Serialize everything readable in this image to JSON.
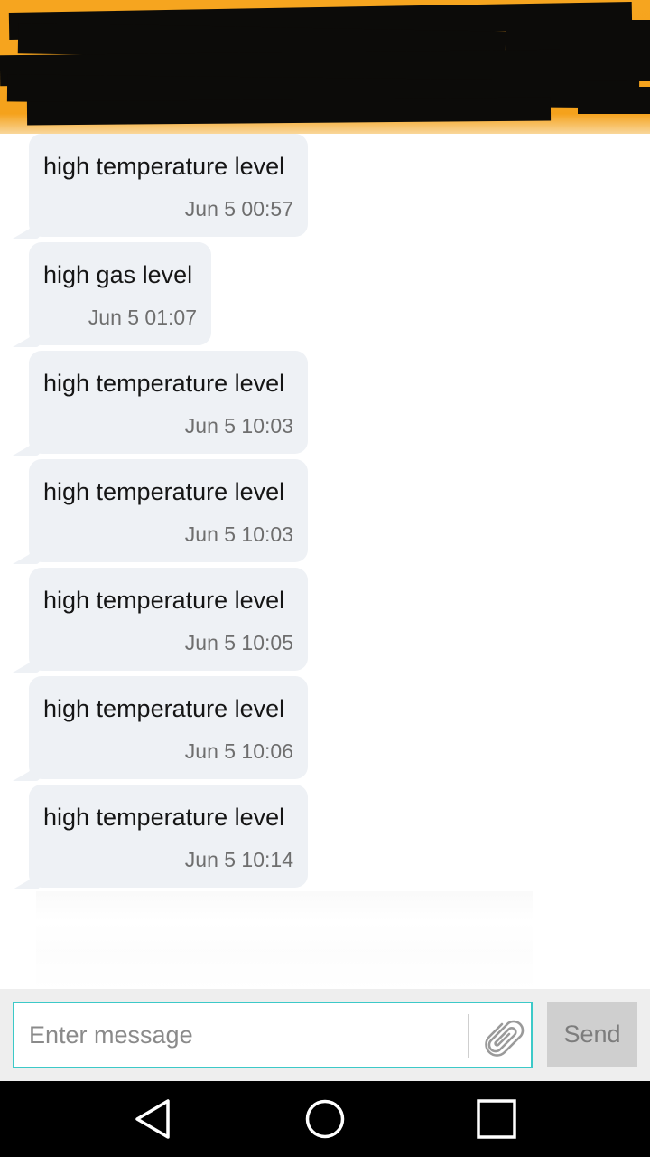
{
  "messages": [
    {
      "text": "high temperature level",
      "time": "Jun 5 00:57"
    },
    {
      "text": "high gas level",
      "time": "Jun 5 01:07"
    },
    {
      "text": "high temperature level",
      "time": "Jun 5 10:03"
    },
    {
      "text": "high temperature level",
      "time": "Jun 5 10:03"
    },
    {
      "text": "high temperature level",
      "time": "Jun 5 10:05"
    },
    {
      "text": "high temperature level",
      "time": "Jun 5 10:06"
    },
    {
      "text": "high temperature level",
      "time": "Jun 5 10:14"
    }
  ],
  "composer": {
    "placeholder": "Enter message",
    "send_label": "Send"
  },
  "icons": {
    "attach": "paperclip-icon",
    "back": "back-triangle-icon",
    "home": "home-circle-icon",
    "recents": "recents-square-icon"
  },
  "colors": {
    "header": "#f5a21c",
    "bubble": "#eef1f5",
    "input_border": "#3cc9c8",
    "send_button": "#cfcfcf"
  }
}
